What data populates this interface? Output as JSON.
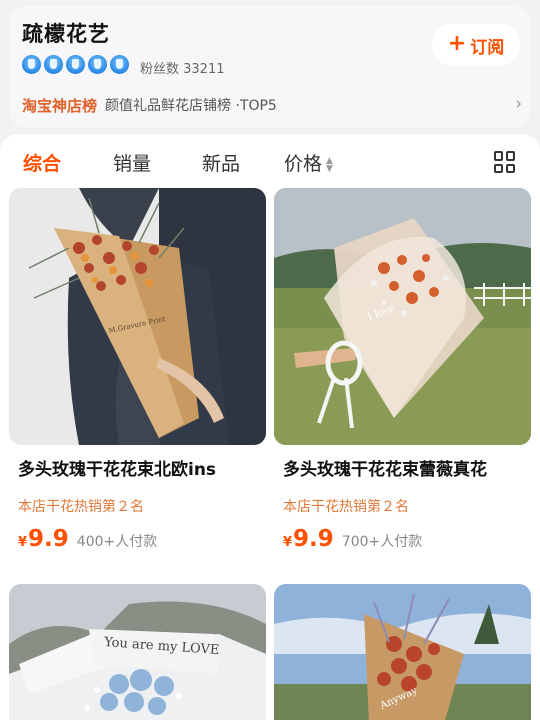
{
  "shop": {
    "name": "疏檬花艺",
    "badge_count": 5,
    "badge_icon": "diamond-crown-icon",
    "fans_label": "粉丝数 33211",
    "subscribe_label": "订阅",
    "rank_tag": "淘宝神店榜",
    "rank_text": "颜值礼品鲜花店铺榜 ·TOP5"
  },
  "tabs": [
    {
      "label": "综合",
      "active": true
    },
    {
      "label": "销量",
      "active": false
    },
    {
      "label": "新品",
      "active": false
    },
    {
      "label": "价格",
      "active": false
    }
  ],
  "colors": {
    "accent": "#ff5000",
    "rank": "#e0612a",
    "tag": "#e07a3a"
  },
  "products": [
    {
      "title": "多头玫瑰干花花束北欧ins",
      "tag": "本店干花热销第２名",
      "currency": "¥",
      "price": "9.9",
      "sold": "400+人付款",
      "wrap_text": "M.Gravure Print"
    },
    {
      "title": "多头玫瑰干花花束蕾薇真花",
      "tag": "本店干花热销第２名",
      "currency": "¥",
      "price": "9.9",
      "sold": "700+人付款",
      "wrap_text": "I love"
    },
    {
      "wrap_text": "You are my LOVE"
    },
    {
      "wrap_text": "Anyway"
    }
  ]
}
